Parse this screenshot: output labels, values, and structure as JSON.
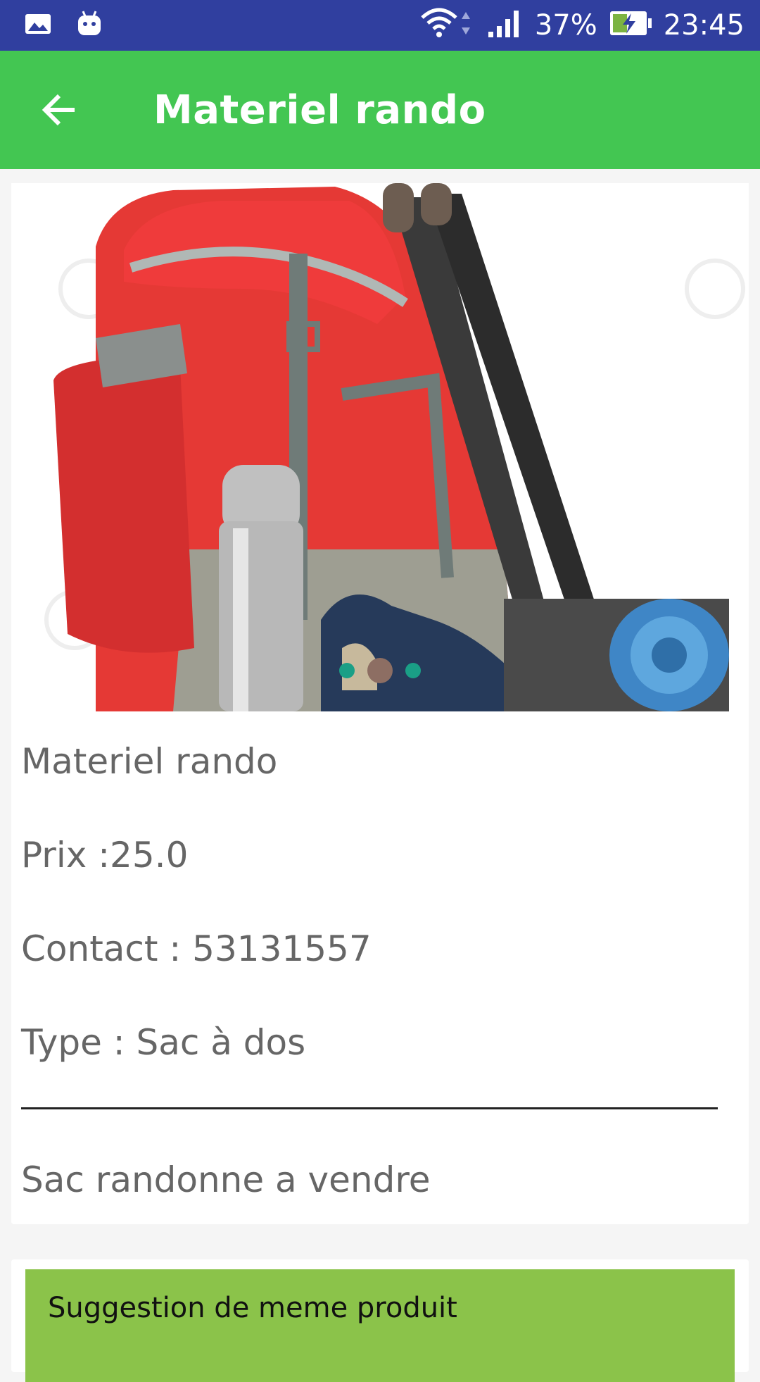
{
  "status_bar": {
    "battery": "37%",
    "time": "23:45",
    "icons": [
      "gallery-icon",
      "android-icon",
      "wifi-icon",
      "signal-icon",
      "battery-charging-icon"
    ]
  },
  "app_bar": {
    "back_icon": "arrow-back-icon",
    "title": "Materiel rando"
  },
  "product": {
    "image": "backpack-photo",
    "carousel_pages": 3,
    "carousel_active_index": 1,
    "name": "Materiel rando",
    "price": "Prix :25.0",
    "contact": "Contact : 53131557",
    "type": "Type : Sac à dos",
    "description": "Sac randonne a vendre"
  },
  "suggestion": {
    "title": "Suggestion de meme produit"
  },
  "colors": {
    "status_bar": "#303f9f",
    "app_bar": "#43c652",
    "suggestion_bar": "#8bc34a",
    "dot": "#1a9f86",
    "dot_active": "#8d6e63"
  }
}
